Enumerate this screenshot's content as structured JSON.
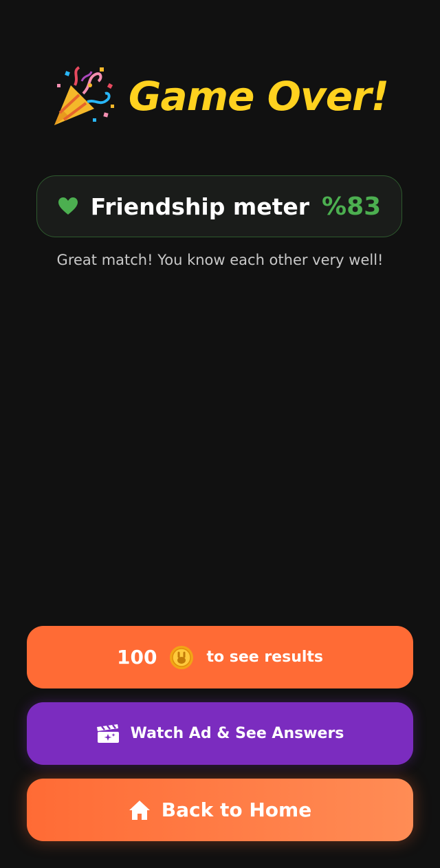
{
  "header": {
    "icon": "party-popper-icon",
    "title": "Game Over!"
  },
  "meter": {
    "icon": "heart-icon",
    "label": "Friendship meter",
    "value": "%83",
    "percent": 83,
    "accent_color": "#4CAF50"
  },
  "message": "Great match! You know each other very well!",
  "buttons": {
    "coins": {
      "amount": "100",
      "icon": "coin-icon",
      "label": "to see results",
      "color": "#FF6B35"
    },
    "watch_ad": {
      "icon": "clapperboard-icon",
      "label": "Watch Ad & See Answers",
      "color": "#7B2CBF"
    },
    "home": {
      "icon": "home-icon",
      "label": "Back to Home",
      "color": "#FF6B35"
    }
  },
  "colors": {
    "background": "#111111",
    "title": "#FFD21F"
  }
}
